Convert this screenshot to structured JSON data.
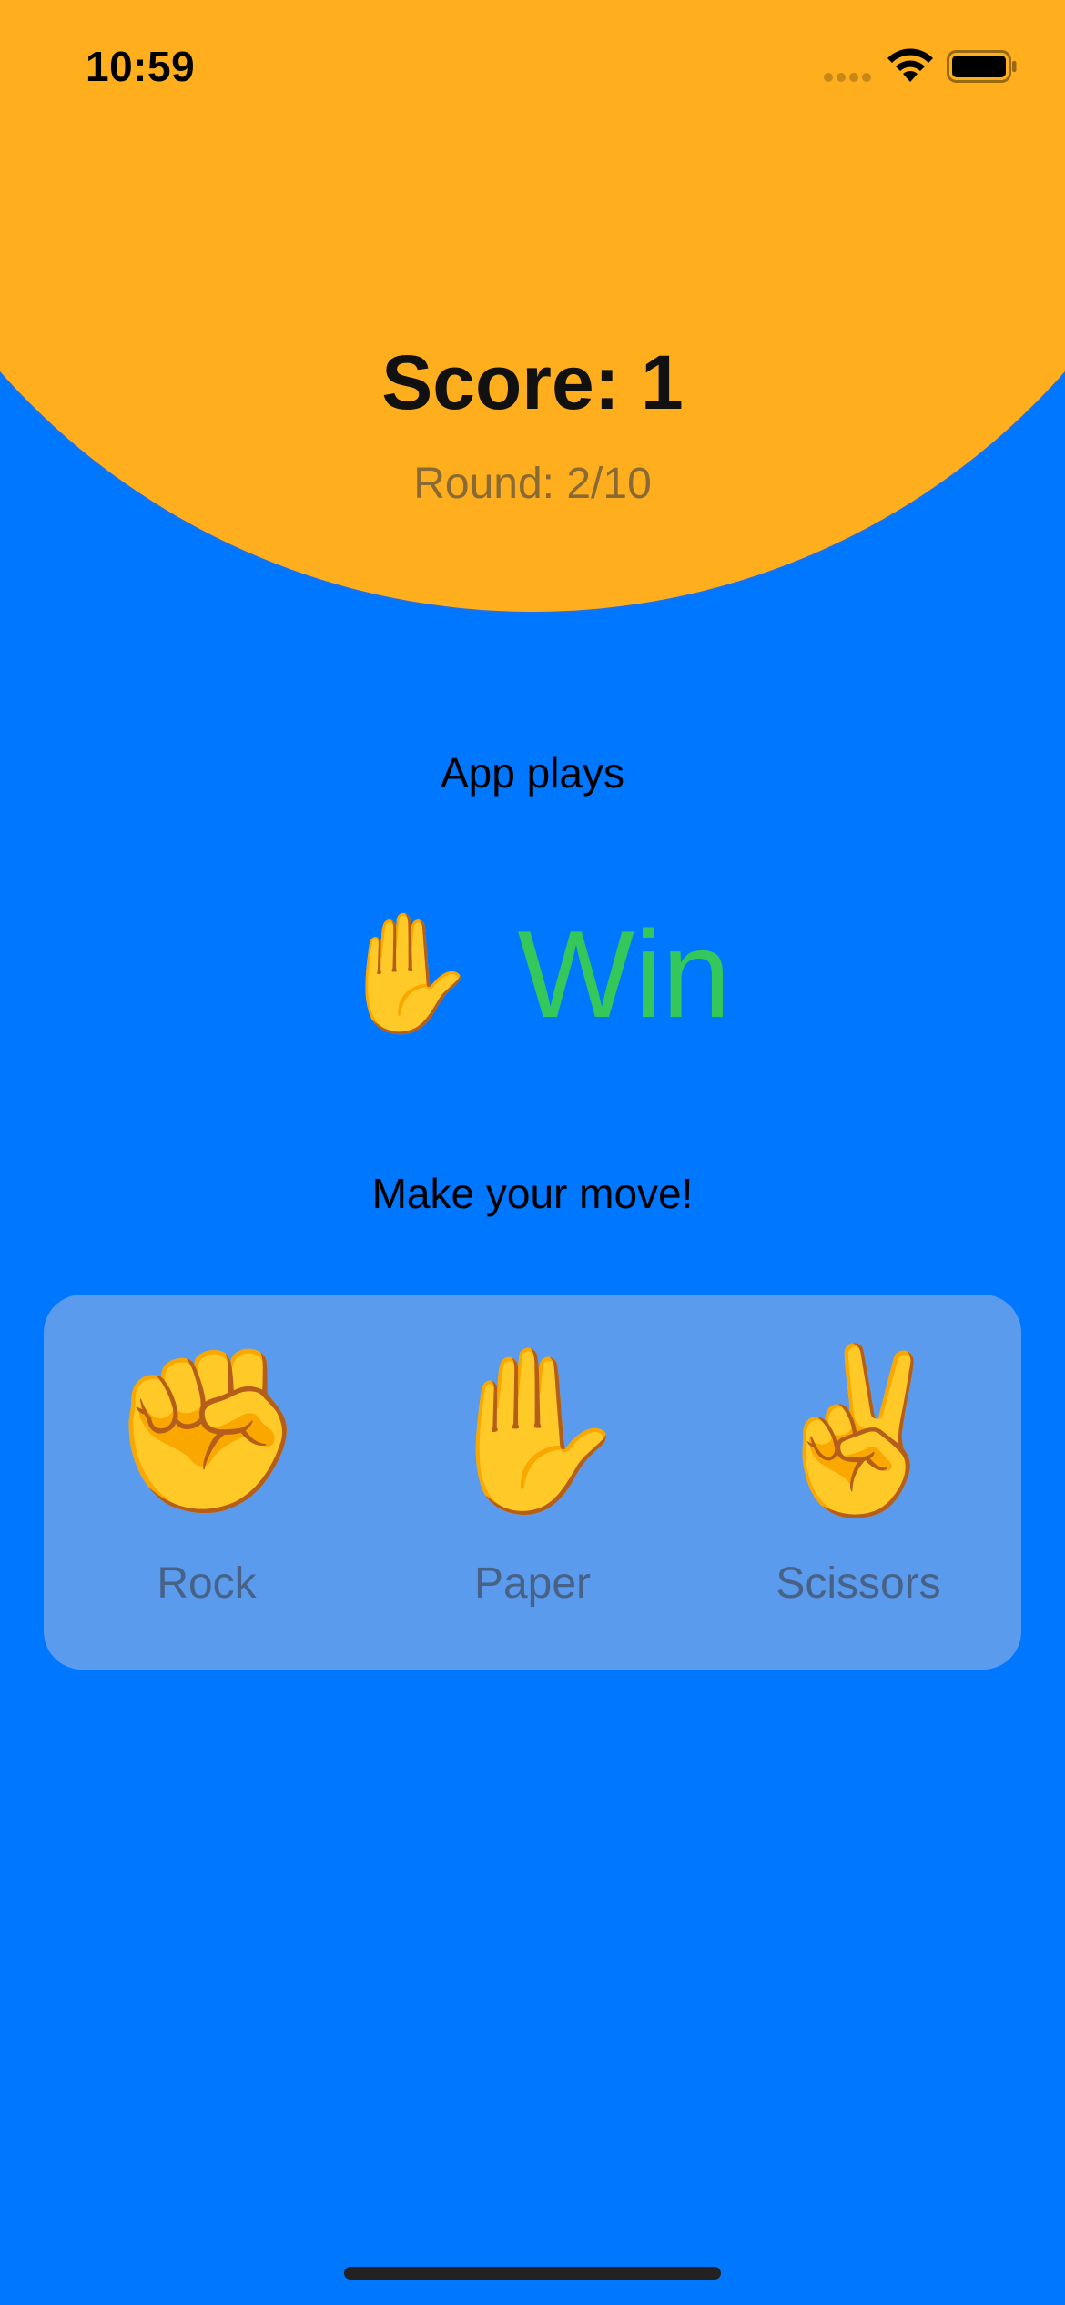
{
  "status_bar": {
    "time": "10:59"
  },
  "header": {
    "score": "Score: 1",
    "round": "Round: 2/10"
  },
  "app": {
    "label": "App plays",
    "move_emoji": "✋",
    "result": "Win"
  },
  "prompt": "Make your move!",
  "choices": [
    {
      "emoji": "✊",
      "label": "Rock"
    },
    {
      "emoji": "✋",
      "label": "Paper"
    },
    {
      "emoji": "✌️",
      "label": "Scissors"
    }
  ],
  "colors": {
    "background": "#0077FF",
    "circle": "#FFAF1E",
    "result": "#34C759"
  }
}
